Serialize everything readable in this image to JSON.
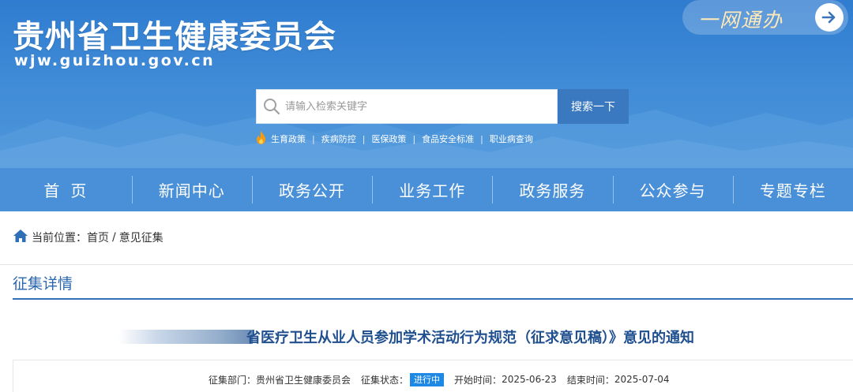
{
  "header": {
    "title": "贵州省卫生健康委员会",
    "domain": "wjw.guizhou.gov.cn",
    "one_net_label": "一网通办"
  },
  "search": {
    "placeholder": "请输入检索关键字",
    "value": "",
    "button_label": "搜索一下"
  },
  "hot_words": [
    "生育政策",
    "疾病防控",
    "医保政策",
    "食品安全标准",
    "职业病查询"
  ],
  "nav": {
    "items": [
      "首页",
      "新闻中心",
      "政务公开",
      "业务工作",
      "政务服务",
      "公众参与",
      "专题专栏"
    ]
  },
  "breadcrumb": {
    "prefix": "当前位置：",
    "items": [
      "首页",
      "意见征集"
    ],
    "separator": "/"
  },
  "section": {
    "title": "征集详情"
  },
  "article": {
    "title": "省医疗卫生从业人员参加学术活动行为规范（征求意见稿）》意见的通知",
    "department_label": "征集部门：",
    "department": "贵州省卫生健康委员会",
    "status_label": "征集状态：",
    "status": "进行中",
    "start_label": "开始时间：",
    "start": "2025-06-23",
    "end_label": "结束时间：",
    "end": "2025-07-04"
  },
  "colors": {
    "banner": "#3f8ad6",
    "nav": "#4a90d8",
    "accent": "#2a67ae",
    "status": "#1e88e5"
  },
  "icons": {
    "search": "search-icon",
    "arrow": "arrow-right-icon",
    "flame": "flame-icon",
    "home": "home-icon"
  }
}
